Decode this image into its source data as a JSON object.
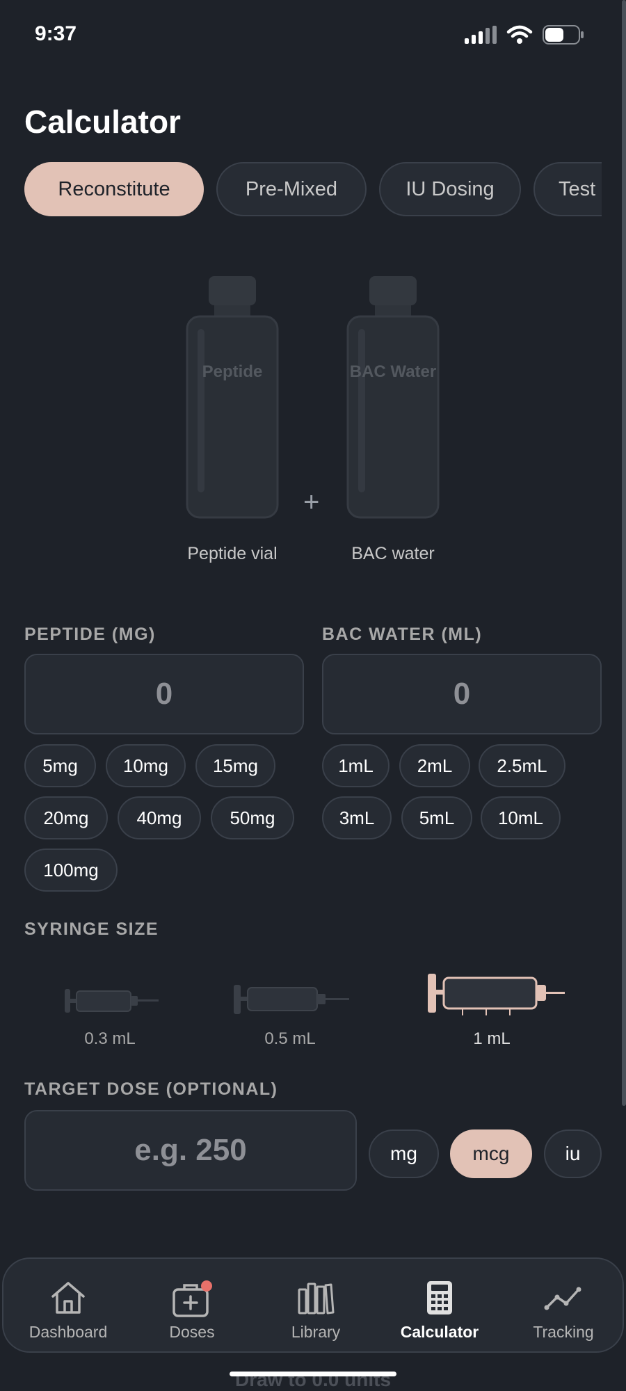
{
  "status": {
    "time": "9:37"
  },
  "page": {
    "title": "Calculator"
  },
  "tabs": [
    {
      "label": "Reconstitute",
      "active": true
    },
    {
      "label": "Pre-Mixed",
      "active": false
    },
    {
      "label": "IU Dosing",
      "active": false
    },
    {
      "label": "Test",
      "active": false
    }
  ],
  "vials": {
    "peptide_text": "Peptide",
    "water_text": "BAC Water",
    "peptide_caption": "Peptide vial",
    "water_caption": "BAC water",
    "plus": "+"
  },
  "peptide": {
    "label": "PEPTIDE (MG)",
    "value": "0",
    "presets": [
      "5mg",
      "10mg",
      "15mg",
      "20mg",
      "40mg",
      "50mg",
      "100mg"
    ]
  },
  "bac_water": {
    "label": "BAC WATER (ML)",
    "value": "0",
    "presets": [
      "1mL",
      "2mL",
      "2.5mL",
      "3mL",
      "5mL",
      "10mL"
    ]
  },
  "syringe": {
    "label": "SYRINGE SIZE",
    "options": [
      {
        "label": "0.3 mL",
        "selected": false
      },
      {
        "label": "0.5 mL",
        "selected": false
      },
      {
        "label": "1 mL",
        "selected": true
      }
    ]
  },
  "target_dose": {
    "label": "TARGET DOSE (OPTIONAL)",
    "placeholder": "e.g. 250",
    "units": [
      {
        "label": "mg",
        "active": false
      },
      {
        "label": "mcg",
        "active": true
      },
      {
        "label": "iu",
        "active": false
      }
    ]
  },
  "behind_text": "Draw to 0.0 units",
  "nav": [
    {
      "label": "Dashboard",
      "icon": "home-icon",
      "active": false
    },
    {
      "label": "Doses",
      "icon": "medical-kit-icon",
      "active": false,
      "badge": true
    },
    {
      "label": "Library",
      "icon": "library-icon",
      "active": false
    },
    {
      "label": "Calculator",
      "icon": "calculator-icon",
      "active": true
    },
    {
      "label": "Tracking",
      "icon": "trend-icon",
      "active": false
    }
  ],
  "colors": {
    "background": "#1e2229",
    "accent": "#e2c2b6",
    "surface": "#262b33",
    "border": "#3a404a",
    "badge": "#e8716a"
  }
}
